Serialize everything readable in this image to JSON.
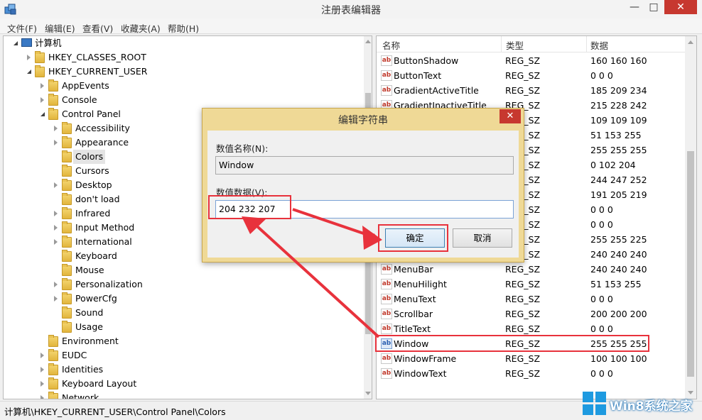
{
  "window": {
    "title": "注册表编辑器",
    "minimize": "—",
    "maximize": "□",
    "close": "✕"
  },
  "menu": [
    "文件(F)",
    "编辑(E)",
    "查看(V)",
    "收藏夹(A)",
    "帮助(H)"
  ],
  "tree": [
    {
      "label": "计算机",
      "indent": 0,
      "state": "open",
      "kind": "computer"
    },
    {
      "label": "HKEY_CLASSES_ROOT",
      "indent": 1,
      "state": "closed"
    },
    {
      "label": "HKEY_CURRENT_USER",
      "indent": 1,
      "state": "open"
    },
    {
      "label": "AppEvents",
      "indent": 2,
      "state": "closed"
    },
    {
      "label": "Console",
      "indent": 2,
      "state": "closed"
    },
    {
      "label": "Control Panel",
      "indent": 2,
      "state": "open"
    },
    {
      "label": "Accessibility",
      "indent": 3,
      "state": "closed"
    },
    {
      "label": "Appearance",
      "indent": 3,
      "state": "closed"
    },
    {
      "label": "Colors",
      "indent": 3,
      "state": "none",
      "selected": true
    },
    {
      "label": "Cursors",
      "indent": 3,
      "state": "none"
    },
    {
      "label": "Desktop",
      "indent": 3,
      "state": "closed"
    },
    {
      "label": "don't load",
      "indent": 3,
      "state": "none"
    },
    {
      "label": "Infrared",
      "indent": 3,
      "state": "closed"
    },
    {
      "label": "Input Method",
      "indent": 3,
      "state": "closed"
    },
    {
      "label": "International",
      "indent": 3,
      "state": "closed"
    },
    {
      "label": "Keyboard",
      "indent": 3,
      "state": "none"
    },
    {
      "label": "Mouse",
      "indent": 3,
      "state": "none"
    },
    {
      "label": "Personalization",
      "indent": 3,
      "state": "closed"
    },
    {
      "label": "PowerCfg",
      "indent": 3,
      "state": "closed"
    },
    {
      "label": "Sound",
      "indent": 3,
      "state": "none"
    },
    {
      "label": "Usage",
      "indent": 3,
      "state": "none"
    },
    {
      "label": "Environment",
      "indent": 2,
      "state": "none"
    },
    {
      "label": "EUDC",
      "indent": 2,
      "state": "closed"
    },
    {
      "label": "Identities",
      "indent": 2,
      "state": "closed"
    },
    {
      "label": "Keyboard Layout",
      "indent": 2,
      "state": "closed"
    },
    {
      "label": "Network",
      "indent": 2,
      "state": "closed"
    }
  ],
  "columns": {
    "name": "名称",
    "type": "类型",
    "data": "数据"
  },
  "values": [
    {
      "name": "ButtonShadow",
      "type": "REG_SZ",
      "data": "160 160 160"
    },
    {
      "name": "ButtonText",
      "type": "REG_SZ",
      "data": "0 0 0"
    },
    {
      "name": "GradientActiveTitle",
      "type": "REG_SZ",
      "data": "185 209 234"
    },
    {
      "name": "GradientInactiveTitle",
      "type": "REG_SZ",
      "data": "215 228 242"
    },
    {
      "name": "",
      "type": "REG_SZ",
      "data": "109 109 109"
    },
    {
      "name": "",
      "type": "REG_SZ",
      "data": "51 153 255"
    },
    {
      "name": "",
      "type": "REG_SZ",
      "data": "255 255 255"
    },
    {
      "name": "",
      "type": "REG_SZ",
      "data": "0 102 204"
    },
    {
      "name": "",
      "type": "REG_SZ",
      "data": "244 247 252"
    },
    {
      "name": "",
      "type": "REG_SZ",
      "data": "191 205 219"
    },
    {
      "name": "",
      "type": "REG_SZ",
      "data": "0 0 0"
    },
    {
      "name": "",
      "type": "REG_SZ",
      "data": "0 0 0"
    },
    {
      "name": "",
      "type": "REG_SZ",
      "data": "255 255 225"
    },
    {
      "name": "",
      "type": "REG_SZ",
      "data": "240 240 240"
    },
    {
      "name": "MenuBar",
      "type": "REG_SZ",
      "data": "240 240 240"
    },
    {
      "name": "MenuHilight",
      "type": "REG_SZ",
      "data": "51 153 255"
    },
    {
      "name": "MenuText",
      "type": "REG_SZ",
      "data": "0 0 0"
    },
    {
      "name": "Scrollbar",
      "type": "REG_SZ",
      "data": "200 200 200"
    },
    {
      "name": "TitleText",
      "type": "REG_SZ",
      "data": "0 0 0"
    },
    {
      "name": "Window",
      "type": "REG_SZ",
      "data": "255 255 255",
      "selected": true
    },
    {
      "name": "WindowFrame",
      "type": "REG_SZ",
      "data": "100 100 100"
    },
    {
      "name": "WindowText",
      "type": "REG_SZ",
      "data": "0 0 0"
    }
  ],
  "dialog": {
    "title": "编辑字符串",
    "close": "✕",
    "name_label": "数值名称(N):",
    "name_value": "Window",
    "data_label": "数值数据(V):",
    "data_value": "204 232 207",
    "ok": "确定",
    "cancel": "取消"
  },
  "status": {
    "path": "计算机\\HKEY_CURRENT_USER\\Control Panel\\Colors"
  },
  "watermark": {
    "text": "Win8系统之家"
  },
  "colors": {
    "highlight": "#e8323c",
    "dialog_frame": "#efd996",
    "close_red": "#c7382f",
    "watermark_blue": "#1e9ae0"
  }
}
